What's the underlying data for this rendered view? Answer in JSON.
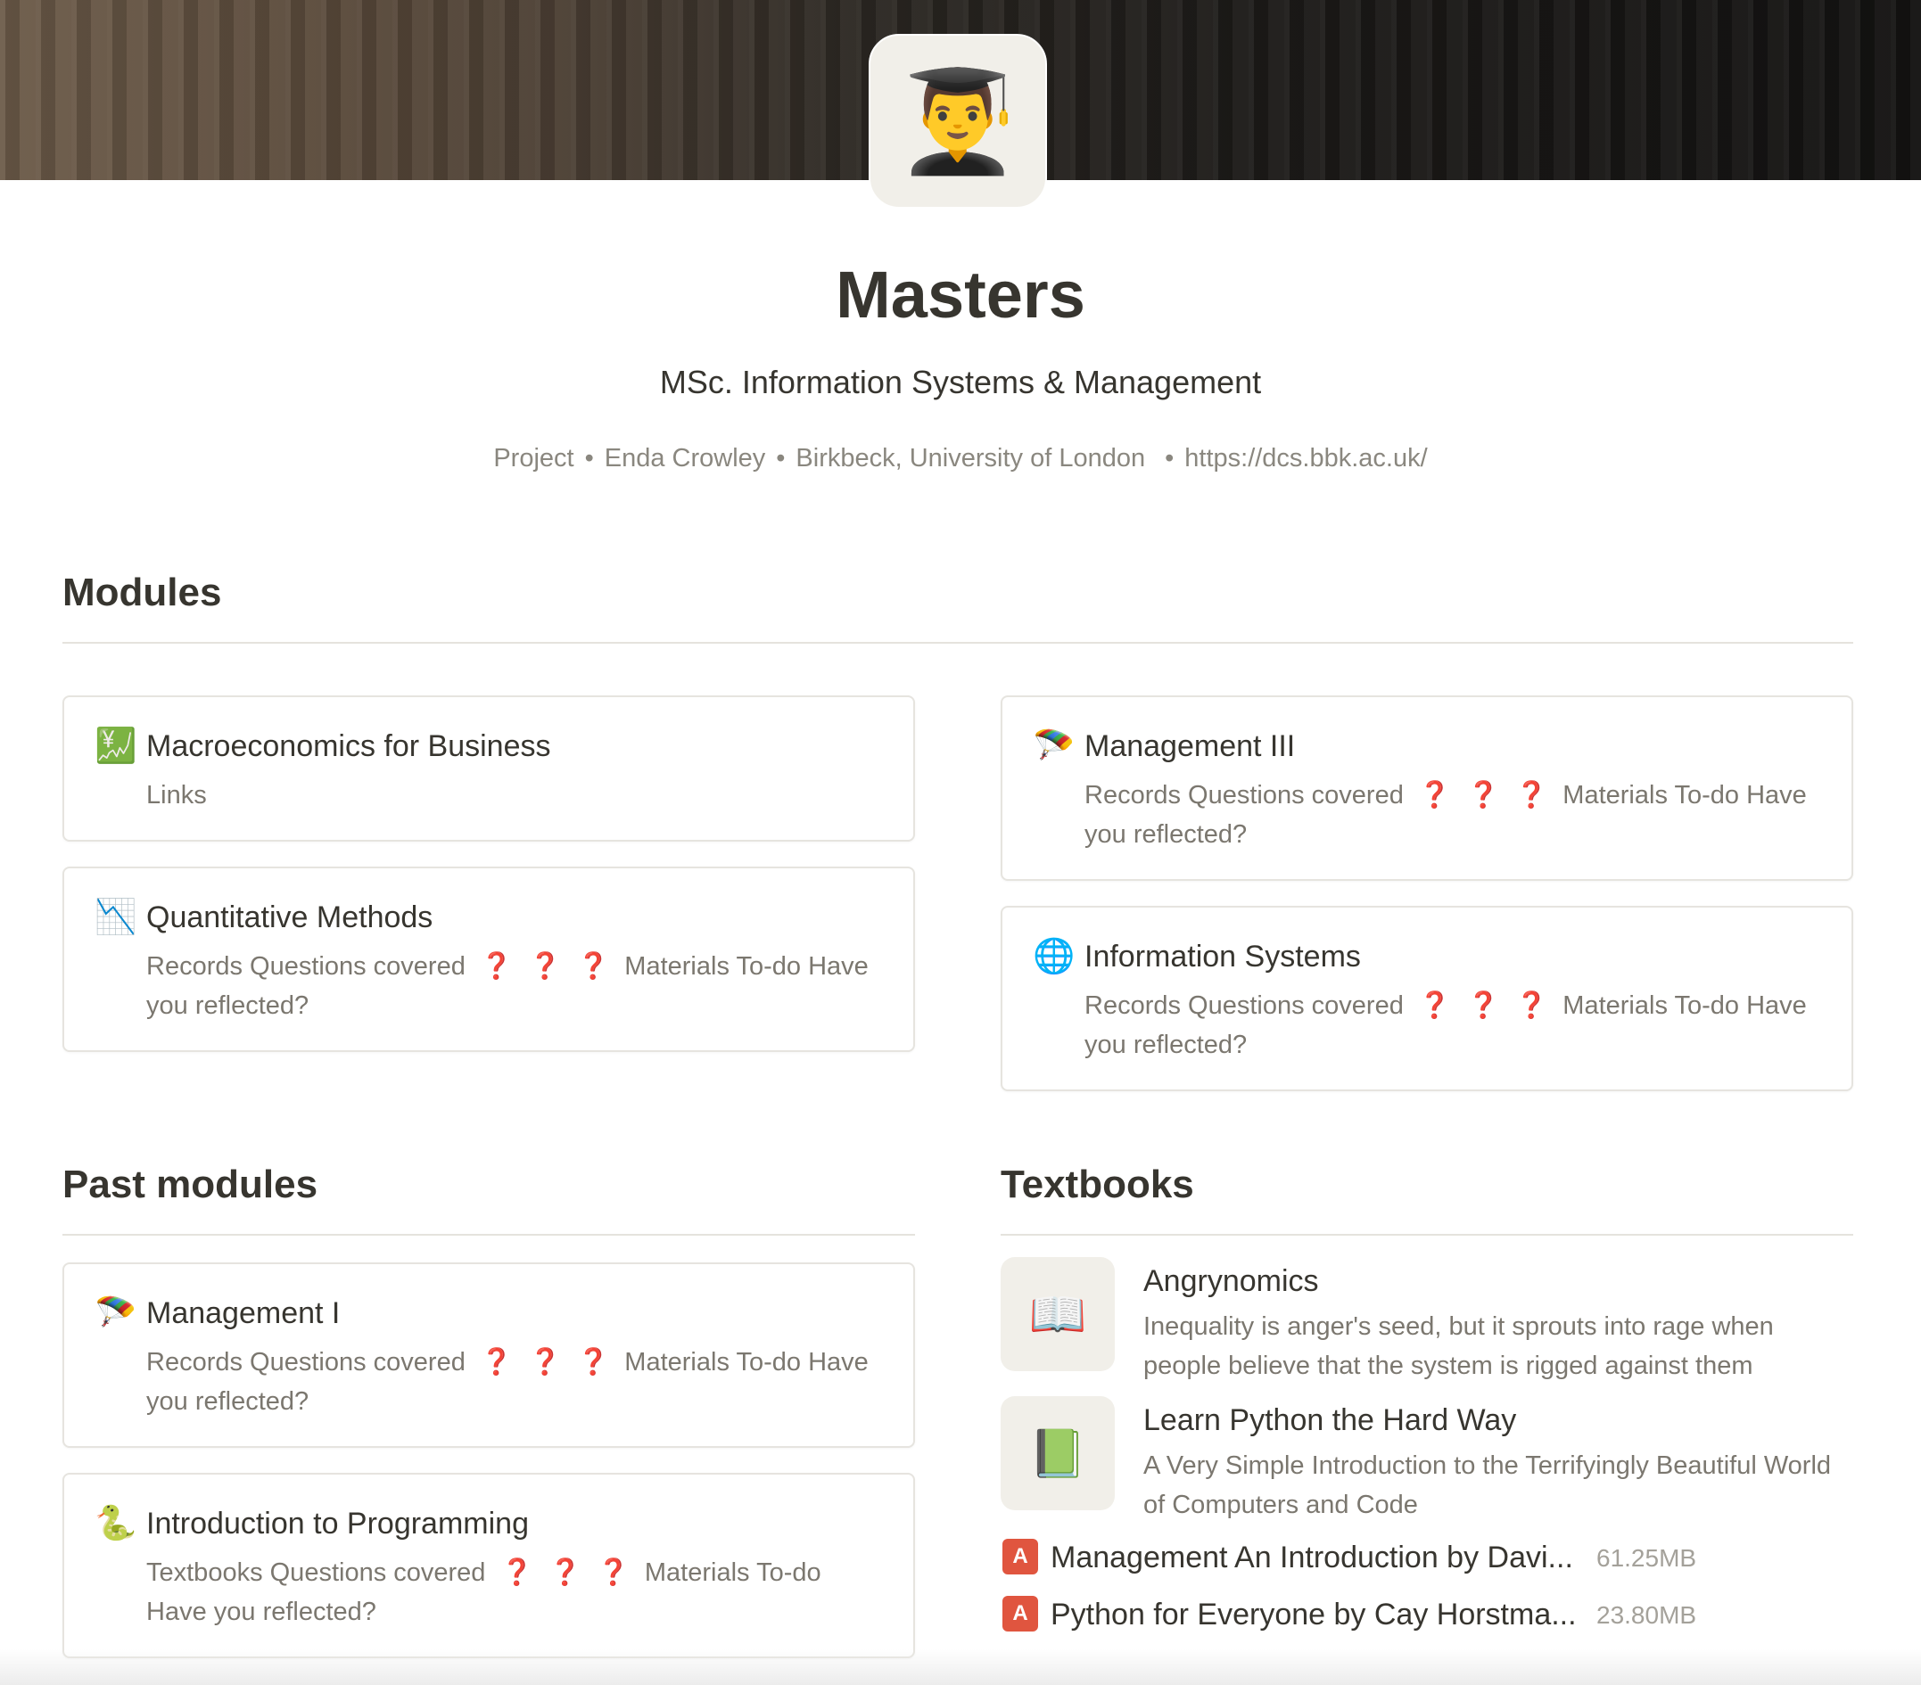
{
  "page": {
    "icon": "👨‍🎓",
    "icon_name": "graduate-icon",
    "title": "Masters",
    "subtitle": "MSc. Information Systems & Management",
    "meta": [
      "Project",
      "Enda Crowley",
      "Birkbeck, University of London",
      "https://dcs.bbk.ac.uk/"
    ]
  },
  "sections": {
    "modules": "Modules",
    "past_modules": "Past modules",
    "textbooks": "Textbooks"
  },
  "modules": [
    {
      "icon": "💹",
      "icon_name": "chart-yen-icon",
      "title": "Macroeconomics for Business",
      "desc": "Links",
      "questions": false
    },
    {
      "icon": "🪂",
      "icon_name": "parachute-icon",
      "title": "Management III",
      "desc_a": "Records Questions covered",
      "desc_b": "Materials To-do Have you reflected?",
      "questions": true
    },
    {
      "icon": "📉",
      "icon_name": "chart-decreasing-icon",
      "title": "Quantitative Methods",
      "desc_a": "Records Questions covered",
      "desc_b": "Materials To-do Have you reflected?",
      "questions": true
    },
    {
      "icon": "🌐",
      "icon_name": "globe-icon",
      "title": "Information Systems",
      "desc_a": "Records Questions covered",
      "desc_b": "Materials To-do Have you reflected?",
      "questions": true
    }
  ],
  "past_modules": [
    {
      "icon": "🪂",
      "icon_name": "parachute-icon",
      "title": "Management I",
      "desc_a": "Records Questions covered",
      "desc_b": "Materials To-do Have you reflected?"
    },
    {
      "icon": "🐍",
      "icon_name": "snake-icon",
      "title": "Introduction to Programming",
      "desc_a": "Textbooks Questions covered",
      "desc_b": "Materials To-do Have you reflected?"
    }
  ],
  "question_mark": "❓",
  "textbooks": [
    {
      "icon": "📖",
      "icon_name": "open-book-icon",
      "title": "Angrynomics",
      "desc": "Inequality is anger's seed, but it sprouts into rage when people believe that the system is rigged against them"
    },
    {
      "icon": "📗",
      "icon_name": "green-book-icon",
      "title": "Learn Python the Hard Way",
      "desc": "A Very Simple Introduction to the Terrifyingly Beautiful World of Computers and Code"
    }
  ],
  "files": [
    {
      "icon_name": "pdf-icon",
      "name": "Management An Introduction by Davi...",
      "size": "61.25MB"
    },
    {
      "icon_name": "pdf-icon",
      "name": "Python for Everyone by Cay Horstma...",
      "size": "23.80MB"
    }
  ],
  "colors": {
    "accent_red": "#e03e3e",
    "pdf_red": "#e0553f",
    "text": "#37352f",
    "muted": "#7b776f"
  }
}
